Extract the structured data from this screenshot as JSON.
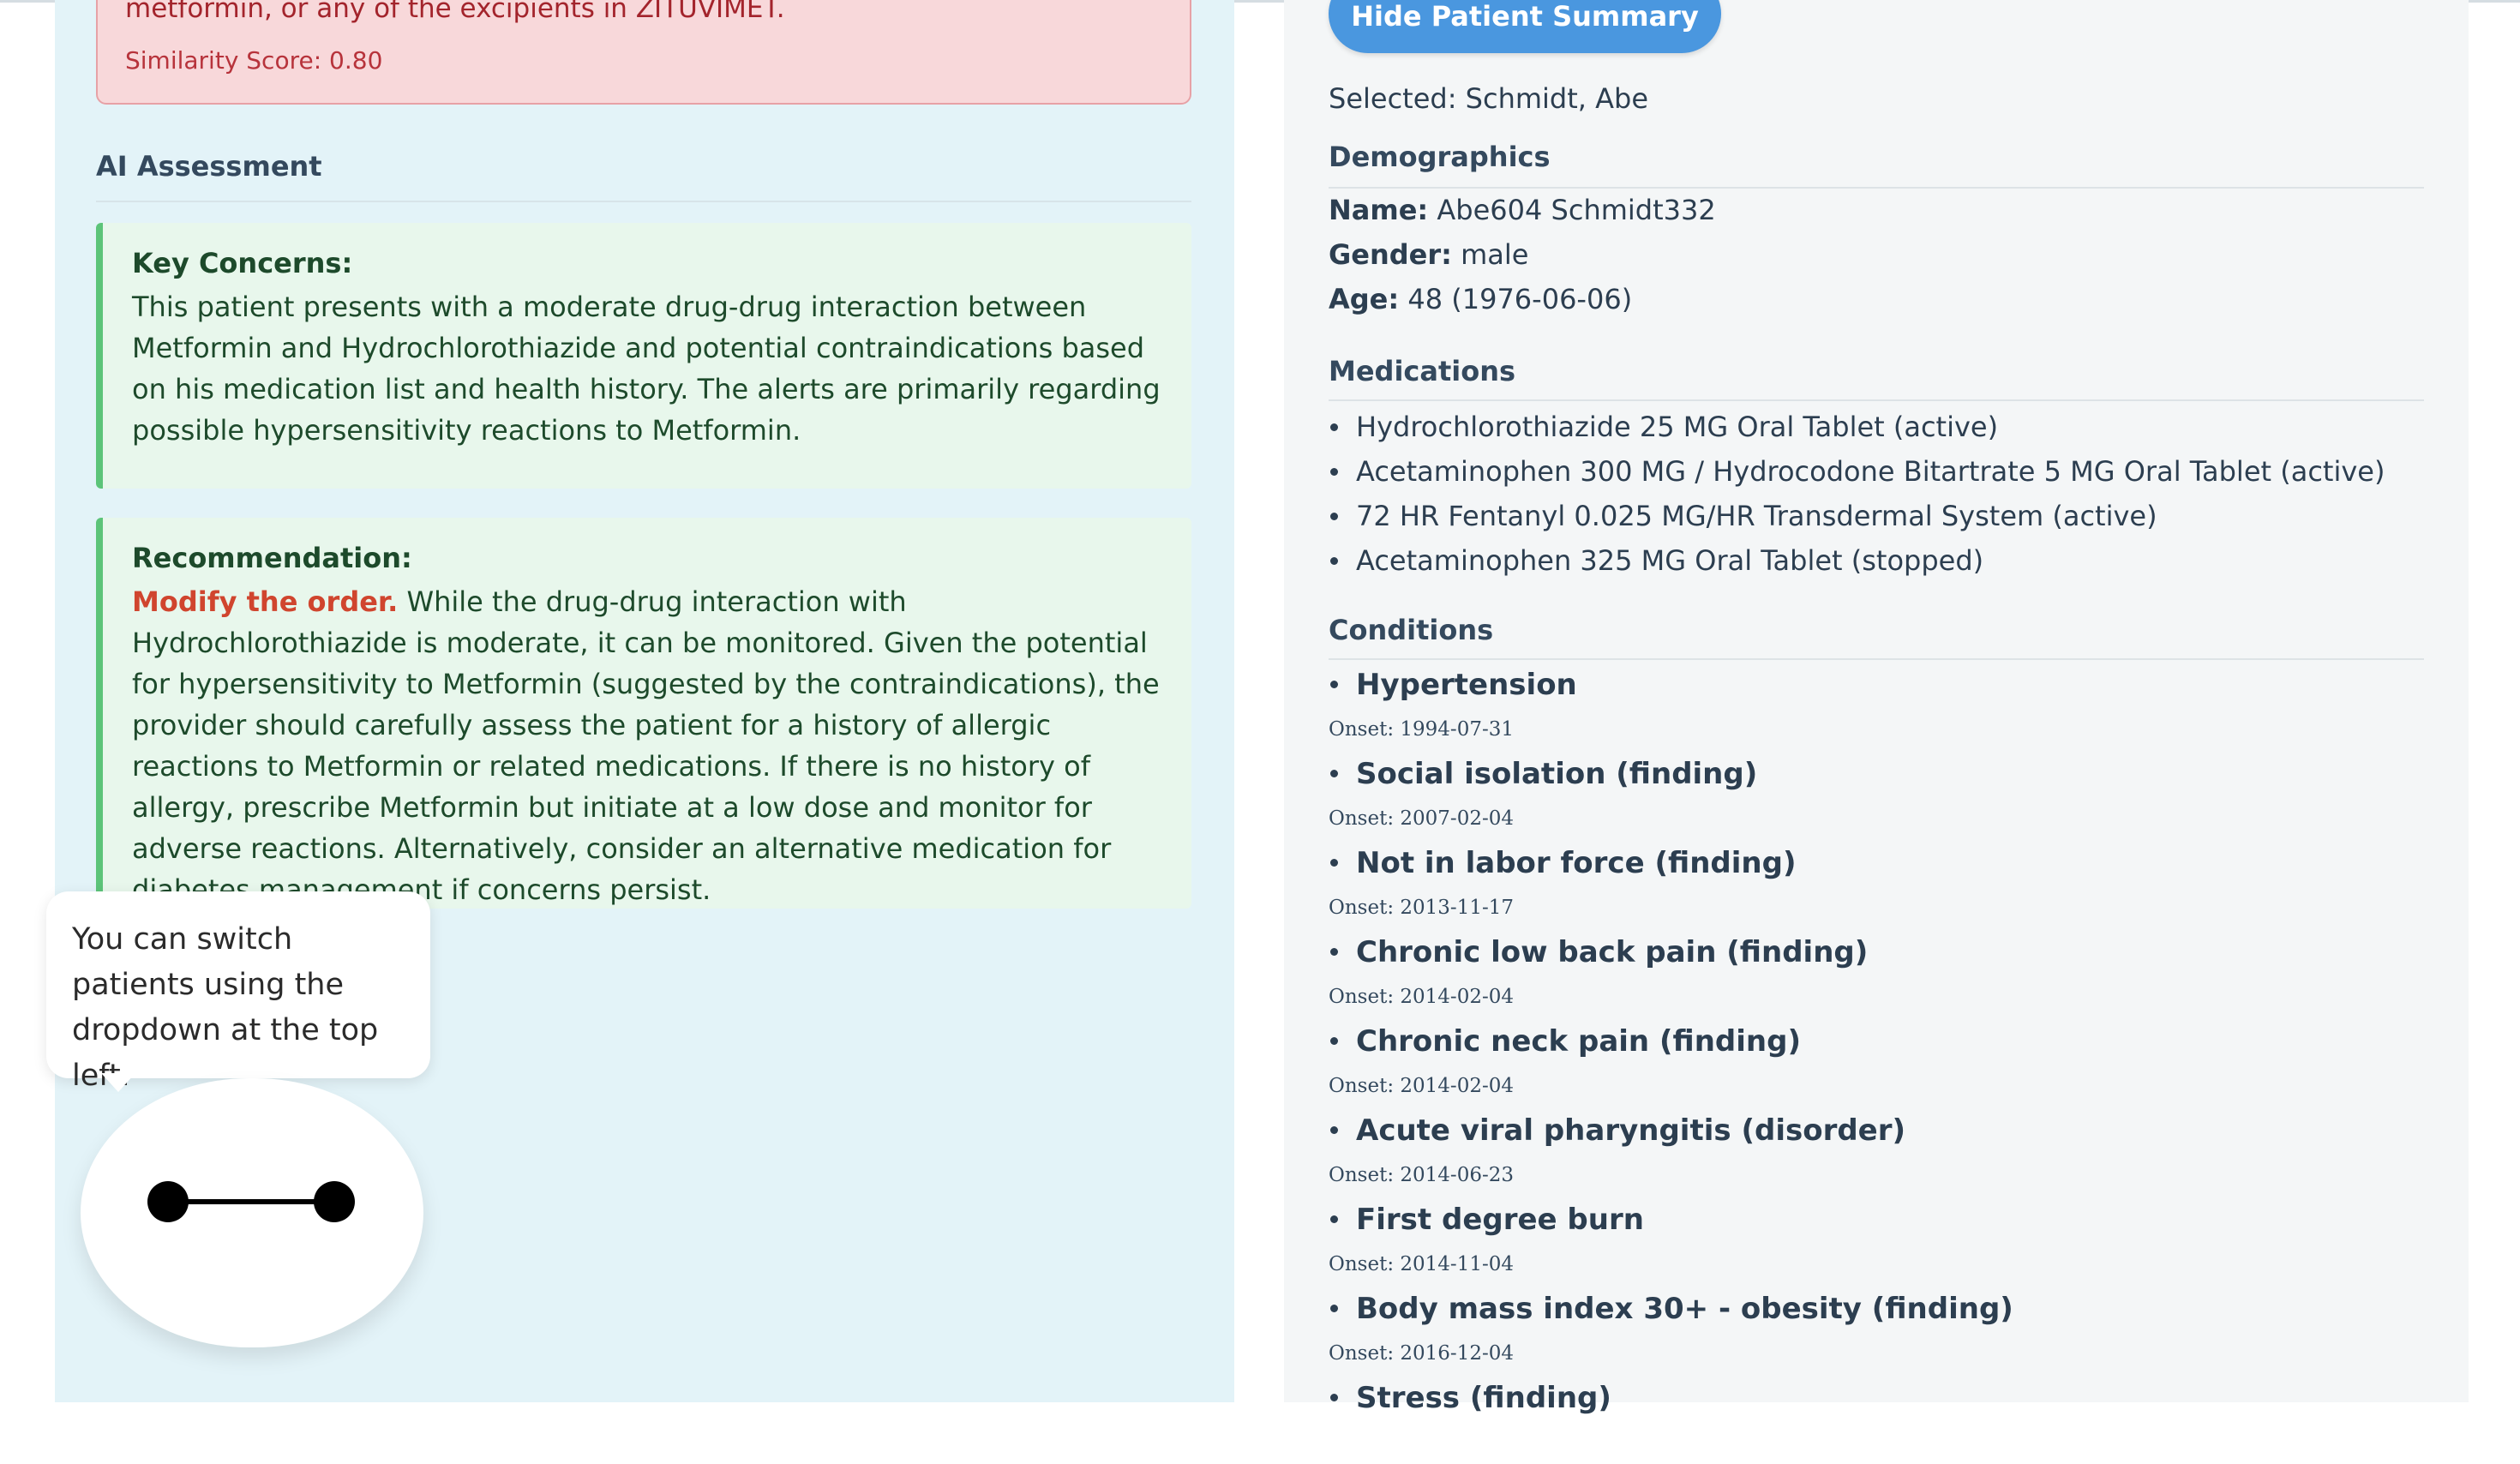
{
  "alert": {
    "text": "metformin, or any of the excipients in ZITUVIMET.",
    "score": "Similarity Score: 0.80"
  },
  "assessment": {
    "title": "AI Assessment",
    "key_concerns": {
      "heading": "Key Concerns:",
      "body": "This patient presents with a moderate drug-drug interaction between Metformin and Hydrochlorothiazide and potential contraindications based on his medication list and health history. The alerts are primarily regarding possible hypersensitivity reactions to Metformin."
    },
    "recommendation": {
      "heading": "Recommendation:",
      "emphasis": "Modify the order.",
      "body": " While the drug-drug interaction with Hydrochlorothiazide is moderate, it can be monitored. Given the potential for hypersensitivity to Metformin (suggested by the contraindications), the provider should carefully assess the patient for a history of allergic reactions to Metformin or related medications. If there is no history of allergy, prescribe Metformin but initiate at a low dose and monitor for adverse reactions. Alternatively, consider an alternative medication for diabetes management if concerns persist."
    }
  },
  "assistant": {
    "bubble": "You can switch patients using the dropdown at the top left."
  },
  "summary": {
    "hide_button": "Hide Patient Summary",
    "selected": "Selected: Schmidt, Abe",
    "demographics": {
      "heading": "Demographics",
      "name_label": "Name:",
      "name_value": " Abe604 Schmidt332",
      "gender_label": "Gender:",
      "gender_value": " male",
      "age_label": "Age:",
      "age_value": " 48 (1976-06-06)"
    },
    "medications": {
      "heading": "Medications",
      "items": [
        "Hydrochlorothiazide 25 MG Oral Tablet (active)",
        "Acetaminophen 300 MG / Hydrocodone Bitartrate 5 MG Oral Tablet (active)",
        "72 HR Fentanyl 0.025 MG/HR Transdermal System (active)",
        "Acetaminophen 325 MG Oral Tablet (stopped)"
      ]
    },
    "conditions": {
      "heading": "Conditions",
      "items": [
        {
          "name": "Hypertension",
          "onset": "Onset: 1994-07-31"
        },
        {
          "name": "Social isolation (finding)",
          "onset": "Onset: 2007-02-04"
        },
        {
          "name": "Not in labor force (finding)",
          "onset": "Onset: 2013-11-17"
        },
        {
          "name": "Chronic low back pain (finding)",
          "onset": "Onset: 2014-02-04"
        },
        {
          "name": "Chronic neck pain (finding)",
          "onset": "Onset: 2014-02-04"
        },
        {
          "name": "Acute viral pharyngitis (disorder)",
          "onset": "Onset: 2014-06-23"
        },
        {
          "name": "First degree burn",
          "onset": "Onset: 2014-11-04"
        },
        {
          "name": "Body mass index 30+ - obesity (finding)",
          "onset": "Onset: 2016-12-04"
        },
        {
          "name": "Stress (finding)",
          "onset": ""
        }
      ]
    }
  }
}
